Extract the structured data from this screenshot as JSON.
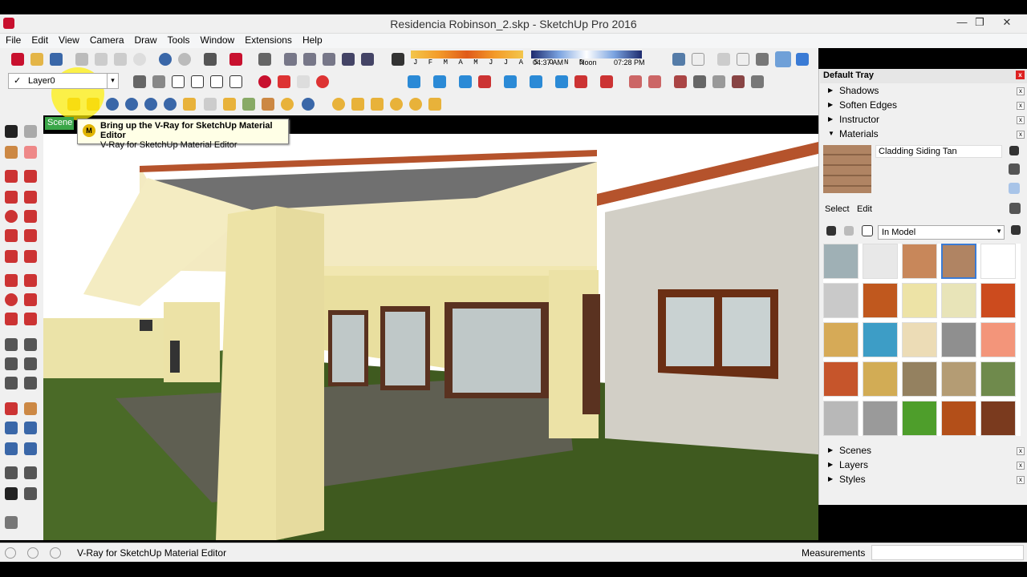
{
  "window": {
    "title": "Residencia Robinson_2.skp - SketchUp Pro 2016",
    "minimize": "—",
    "restore": "❒",
    "close": "✕"
  },
  "menu": [
    "File",
    "Edit",
    "View",
    "Camera",
    "Draw",
    "Tools",
    "Window",
    "Extensions",
    "Help"
  ],
  "layer": {
    "check": "✓",
    "name": "Layer0",
    "dropdown": "▾"
  },
  "shadow_settings": {
    "months": "J F M A M J J A S O N D",
    "time_start": "04:37 AM",
    "time_mid": "Noon",
    "time_end": "07:28 PM"
  },
  "scene_tab": "Scene",
  "tooltip": {
    "icon": "M",
    "title": "Bring up the V-Ray for SketchUp Material Editor",
    "subtitle": "V-Ray for SketchUp Material Editor"
  },
  "tray": {
    "title": "Default Tray",
    "close": "x",
    "sections_top": [
      "Shadows",
      "Soften Edges",
      "Instructor"
    ],
    "materials_label": "Materials",
    "material_name": "Cladding Siding Tan",
    "tab_select": "Select",
    "tab_edit": "Edit",
    "collection": "In Model",
    "sections_bottom": [
      "Scenes",
      "Layers",
      "Styles"
    ],
    "expand_arrow": "▶",
    "open_arrow": "▼",
    "swatch_colors": [
      "#9fb0b5",
      "#e8e8e8",
      "#c8875a",
      "#b08463",
      "#ffffff",
      "#c9c9c9",
      "#c0581e",
      "#ede3a6",
      "#e8e4b8",
      "#cc4b1e",
      "#d6aa57",
      "#3d9dc6",
      "#ecdcb6",
      "#8f8f8f",
      "#f3957a",
      "#c6552b",
      "#d2ac55",
      "#948160",
      "#b49c74",
      "#6f8a4c",
      "#b8b8b8",
      "#9a9a9a",
      "#4e9e2b",
      "#b34f19",
      "#7a3a1e"
    ]
  },
  "status": {
    "text": "V-Ray for SketchUp Material Editor",
    "measurements": "Measurements"
  }
}
